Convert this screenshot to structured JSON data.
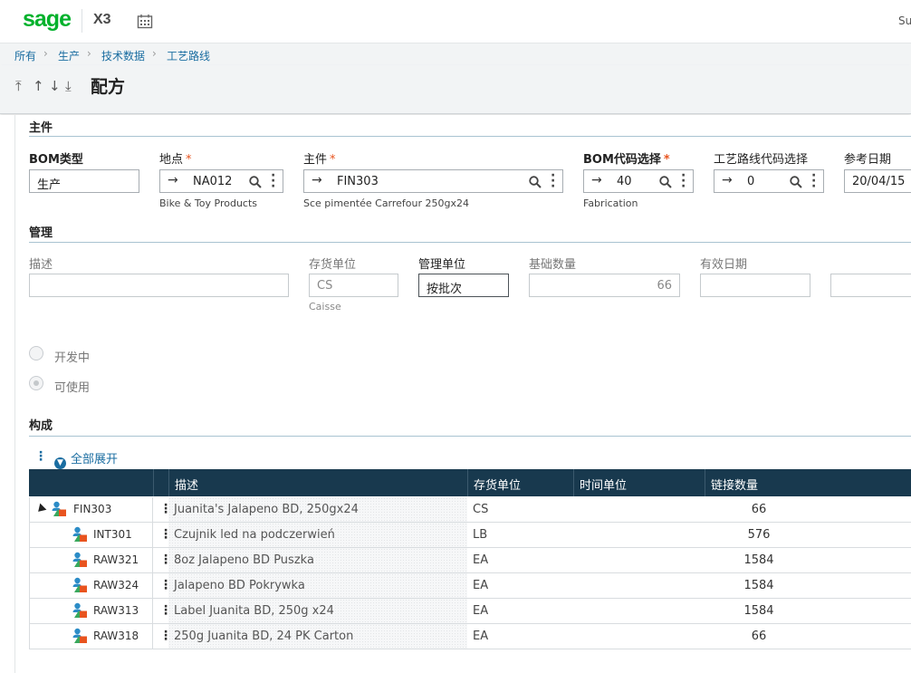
{
  "app": {
    "logo": "sage",
    "name": "X3",
    "user": "Su"
  },
  "icons": {
    "calendar": "calendar-icon",
    "search": "magnifier-icon",
    "more": "vertical-dots-icon",
    "item": "item-person-icon"
  },
  "colors": {
    "brand": "#00b12b",
    "link": "#1a6da1",
    "table_header": "#18394e",
    "required": "#e8541f"
  },
  "breadcrumb": [
    "所有",
    "生产",
    "技术数据",
    "工艺路线"
  ],
  "nav_arrows": {
    "first": "⤒",
    "prev": "↑",
    "next": "↓",
    "last": "⤓"
  },
  "page_title": "配方",
  "section_main": {
    "title": "主件",
    "bom_type": {
      "label": "BOM类型",
      "value": "生产"
    },
    "site": {
      "label": "地点",
      "value": "NA012",
      "sub": "Bike & Toy Products"
    },
    "item": {
      "label": "主件",
      "value": "FIN303",
      "sub": "Sce pimentée Carrefour 250gx24"
    },
    "bom_code": {
      "label": "BOM代码选择",
      "value": "40",
      "sub": "Fabrication"
    },
    "routing_code": {
      "label": "工艺路线代码选择",
      "value": "0"
    },
    "ref_date": {
      "label": "参考日期",
      "value": "20/04/15"
    }
  },
  "section_mgmt": {
    "title": "管理",
    "description": {
      "label": "描述",
      "value": ""
    },
    "stock_unit": {
      "label": "存货单位",
      "value": "CS",
      "sub": "Caisse"
    },
    "mgmt_unit": {
      "label": "管理单位",
      "value": "按批次"
    },
    "base_qty": {
      "label": "基础数量",
      "value": "66"
    },
    "valid_date": {
      "label": "有效日期",
      "value": ""
    },
    "status_options": [
      "开发中",
      "可使用"
    ]
  },
  "section_components": {
    "title": "构成",
    "expand_all": "全部展开",
    "columns": [
      "描述",
      "存货单位",
      "时间单位",
      "链接数量"
    ],
    "rows": [
      {
        "code": "FIN303",
        "desc": "Juanita's Jalapeno BD, 250gx24",
        "unit": "CS",
        "time_unit": "",
        "qty": "66"
      },
      {
        "code": "INT301",
        "desc": "Czujnik led na podczerwień",
        "unit": "LB",
        "time_unit": "",
        "qty": "576"
      },
      {
        "code": "RAW321",
        "desc": "8oz Jalapeno BD Puszka",
        "unit": "EA",
        "time_unit": "",
        "qty": "1584"
      },
      {
        "code": "RAW324",
        "desc": "Jalapeno BD Pokrywka",
        "unit": "EA",
        "time_unit": "",
        "qty": "1584"
      },
      {
        "code": "RAW313",
        "desc": "Label Juanita BD, 250g x24",
        "unit": "EA",
        "time_unit": "",
        "qty": "1584"
      },
      {
        "code": "RAW318",
        "desc": "250g Juanita BD, 24 PK Carton",
        "unit": "EA",
        "time_unit": "",
        "qty": "66"
      }
    ]
  }
}
